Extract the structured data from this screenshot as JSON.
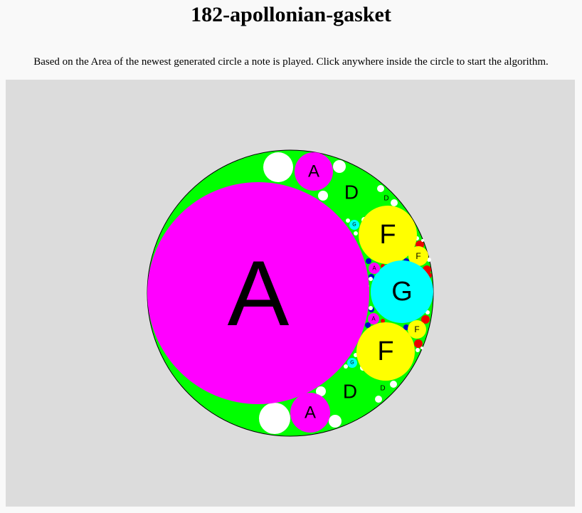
{
  "page": {
    "title": "182-apollonian-gasket",
    "description": "Based on the Area of the newest generated circle a note is played. Click anywhere inside the circle to start the algorithm."
  },
  "colors": {
    "canvas_bg": "#dcdcdc",
    "outer": "#00ff00",
    "A": "#ff00ff",
    "D": "#00ff00",
    "F": "#ffff00",
    "G": "#00ffff",
    "unlabeled_white": "#ffffff",
    "unlabeled_red": "#ee0000",
    "unlabeled_blue": "#0000cc"
  },
  "circles": [
    {
      "note": "A",
      "color": "A"
    },
    {
      "note": "A",
      "color": "A"
    },
    {
      "note": "A",
      "color": "A"
    },
    {
      "note": "D",
      "color": "D"
    },
    {
      "note": "D",
      "color": "D"
    },
    {
      "note": "D",
      "color": "D"
    },
    {
      "note": "D",
      "color": "D"
    },
    {
      "note": "F",
      "color": "F"
    },
    {
      "note": "F",
      "color": "F"
    },
    {
      "note": "F",
      "color": "F"
    },
    {
      "note": "F",
      "color": "F"
    },
    {
      "note": "G",
      "color": "G"
    },
    {
      "note": "G",
      "color": "G"
    },
    {
      "note": "G",
      "color": "G"
    },
    {
      "note": "A",
      "color": "A"
    },
    {
      "note": "A",
      "color": "A"
    }
  ]
}
